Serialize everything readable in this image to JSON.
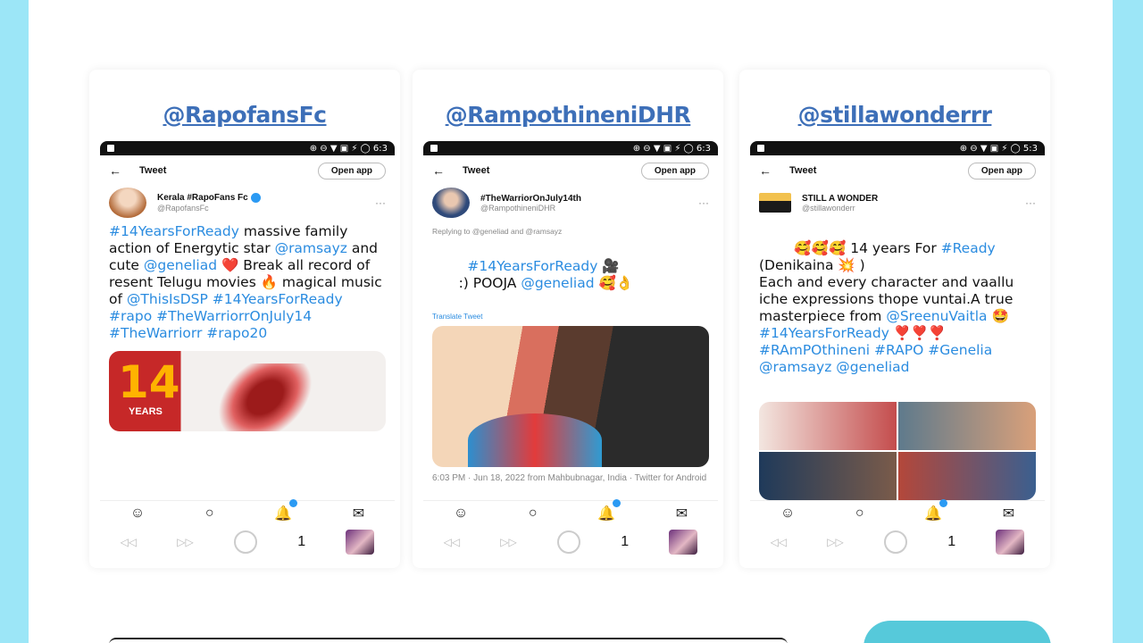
{
  "colors": {
    "frame": "#9ce6f7",
    "handle": "#3d6fb8",
    "tag": "#2b8ce0",
    "verified": "#2b9af3"
  },
  "cards": [
    {
      "handle": "@RapofansFc",
      "status": "⊕ ⊖ ▼ ▣ ⚡ ◯ 6:3",
      "header_title": "Tweet",
      "open_app": "Open app",
      "author_name": "Kerala #RapoFans Fc",
      "author_handle": "@RapofansFc",
      "text_1": "#14YearsForReady",
      "text_2": " massive family action of Energytic star ",
      "text_3": "@ramsayz",
      "text_4": "  and cute ",
      "text_5": "@geneliad",
      "text_6": " ❤️ Break all record of resent Telugu movies 🔥 magical music of ",
      "text_7": "@ThisIsDSP #14YearsForReady #rapo #TheWarriorrOnJuly14 #TheWarriorr #rapo20",
      "media_number": "14",
      "media_years": "YEARS"
    },
    {
      "handle": "@RampothineniDHR",
      "status": "⊕ ⊖ ▼ ▣ ⚡ ◯ 6:3",
      "header_title": "Tweet",
      "open_app": "Open app",
      "author_name": "#TheWarriorOnJuly14th",
      "author_handle": "@RampothineniDHR",
      "reply_line": "Replying to @geneliad and @ramsayz",
      "text_1": "#14YearsForReady",
      "text_2": " 🎥\n      :) POOJA ",
      "text_3": "@geneliad",
      "text_4": " 🥰👌",
      "translate": "Translate Tweet",
      "meta": "6:03 PM · Jun 18, 2022 from Mahbubnagar, India · Twitter for Android"
    },
    {
      "handle": "@stillawonderrr",
      "status": "⊕ ⊖ ▼ ▣ ⚡ ◯ 5:3",
      "header_title": "Tweet",
      "open_app": "Open app",
      "author_name": "STILL A WONDER",
      "author_handle": "@stillawonderr",
      "text_1": "🥰🥰🥰 14 years For ",
      "text_2": "#Ready",
      "text_3": " (Denikaina 💥 )\nEach and every character and vaallu iche expressions thope vuntai.A true masterpiece from ",
      "text_4": "@SreenuVaitla",
      "text_5": " 🤩 ",
      "text_6": "#14YearsForReady",
      "text_7": " ❣️❣️❣️ ",
      "text_8": "#RAmPOthineni #RAPO #Genelia @ramsayz @geneliad"
    }
  ],
  "nav": {
    "home_icon": "☺",
    "search_icon": "○",
    "bell_icon": "🔔",
    "mail_icon": "✉"
  },
  "sys": {
    "back": "◁◁",
    "forward": "▷▷",
    "count": "1"
  }
}
